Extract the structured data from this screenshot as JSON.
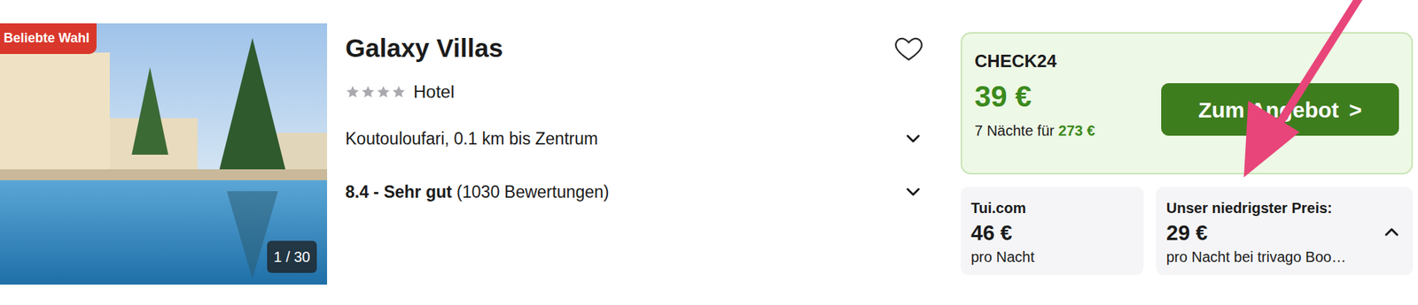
{
  "hotel": {
    "badge": "Beliebte Wahl",
    "photo_counter": "1 / 30",
    "name": "Galaxy Villas",
    "favorite": false,
    "stars": 4,
    "type": "Hotel",
    "location": "Koutouloufari, 0.1 km bis Zentrum",
    "location_expanded": false,
    "rating": "8.4 - Sehr gut",
    "reviews": "(1030 Bewertungen)",
    "rating_expanded": false
  },
  "main_offer": {
    "provider": "CHECK24",
    "price": "39 €",
    "nights_label": "7 Nächte für",
    "total": "273 €",
    "button": "Zum Angebot",
    "button_icon": ">"
  },
  "other_offers": [
    {
      "provider": "Tui.com",
      "price": "46 €",
      "note": "pro Nacht"
    }
  ],
  "lowest_price": {
    "label": "Unser niedrigster Preis:",
    "price": "29 €",
    "note": "pro Nacht bei trivago Boo…",
    "expanded": true
  }
}
